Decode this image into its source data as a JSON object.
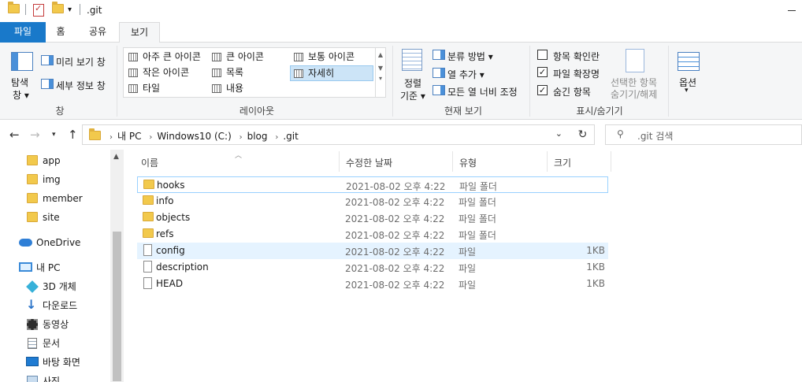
{
  "window": {
    "title": ".git"
  },
  "tabs": {
    "file": "파일",
    "home": "홈",
    "share": "공유",
    "view": "보기"
  },
  "ribbon": {
    "panes": {
      "nav_pane_line1": "탐색",
      "nav_pane_line2": "창 ▾",
      "preview": "미리 보기 창",
      "details": "세부 정보 창",
      "group": "창"
    },
    "layout": {
      "items": [
        "아주 큰 아이콘",
        "큰 아이콘",
        "보통 아이콘",
        "작은 아이콘",
        "목록",
        "자세히",
        "타일",
        "내용"
      ],
      "group": "레이아웃"
    },
    "current_view": {
      "sort_line1": "정렬",
      "sort_line2": "기준 ▾",
      "group_by": "분류 방법 ▾",
      "add_columns": "열 추가 ▾",
      "size_all": "모든 열 너비 조정",
      "group": "현재 보기"
    },
    "show_hide": {
      "item_checkboxes": "항목 확인란",
      "file_extensions": "파일 확장명",
      "hidden_items": "숨긴 항목",
      "hide_selected_line1": "선택한 항목",
      "hide_selected_line2": "숨기기/해제",
      "group": "표시/숨기기",
      "checked": {
        "item_checkboxes": false,
        "file_extensions": true,
        "hidden_items": true
      }
    },
    "options": {
      "label": "옵션"
    }
  },
  "address": {
    "crumbs": [
      "내 PC",
      "Windows10 (C:)",
      "blog",
      ".git"
    ],
    "search_placeholder": ".git 검색"
  },
  "nav_pane": {
    "items": [
      {
        "label": "app",
        "icon": "folder-icon"
      },
      {
        "label": "img",
        "icon": "folder-icon"
      },
      {
        "label": "member",
        "icon": "folder-icon"
      },
      {
        "label": "site",
        "icon": "folder-icon"
      },
      {
        "label": "OneDrive",
        "icon": "cloud-icon"
      },
      {
        "label": "내 PC",
        "icon": "pc-icon"
      },
      {
        "label": "3D 개체",
        "icon": "3d-objects-icon"
      },
      {
        "label": "다운로드",
        "icon": "download-icon"
      },
      {
        "label": "동영상",
        "icon": "video-icon"
      },
      {
        "label": "문서",
        "icon": "document-icon"
      },
      {
        "label": "바탕 화면",
        "icon": "desktop-icon"
      },
      {
        "label": "사진",
        "icon": "pictures-icon"
      }
    ]
  },
  "file_list": {
    "columns": {
      "name": "이름",
      "modified": "수정한 날짜",
      "type": "유형",
      "size": "크기"
    },
    "rows": [
      {
        "name": "hooks",
        "modified": "2021-08-02 오후 4:22",
        "type": "파일 폴더",
        "size": "",
        "kind": "folder"
      },
      {
        "name": "info",
        "modified": "2021-08-02 오후 4:22",
        "type": "파일 폴더",
        "size": "",
        "kind": "folder"
      },
      {
        "name": "objects",
        "modified": "2021-08-02 오후 4:22",
        "type": "파일 폴더",
        "size": "",
        "kind": "folder"
      },
      {
        "name": "refs",
        "modified": "2021-08-02 오후 4:22",
        "type": "파일 폴더",
        "size": "",
        "kind": "folder"
      },
      {
        "name": "config",
        "modified": "2021-08-02 오후 4:22",
        "type": "파일",
        "size": "1KB",
        "kind": "file"
      },
      {
        "name": "description",
        "modified": "2021-08-02 오후 4:22",
        "type": "파일",
        "size": "1KB",
        "kind": "file"
      },
      {
        "name": "HEAD",
        "modified": "2021-08-02 오후 4:22",
        "type": "파일",
        "size": "1KB",
        "kind": "file"
      }
    ]
  },
  "colors": {
    "file_tab": "#1979ca",
    "selection_fill": "#e5f3ff",
    "selection_border": "#99d1ff",
    "folder": "#f2c94c"
  }
}
